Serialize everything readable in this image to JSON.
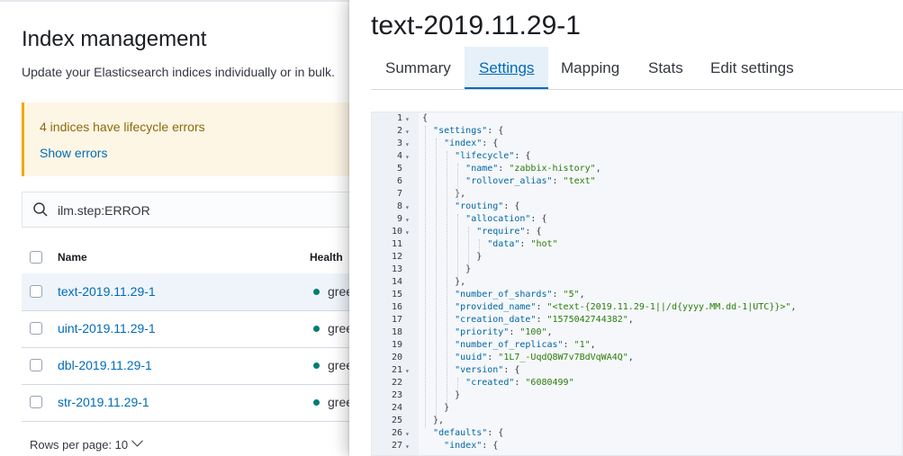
{
  "page": {
    "title": "Index management",
    "description": "Update your Elasticsearch indices individually or in bulk.",
    "callout": {
      "title": "4 indices have lifecycle errors",
      "link": "Show errors"
    },
    "search": {
      "value": "ilm.step:ERROR"
    },
    "table": {
      "headers": {
        "name": "Name",
        "health": "Health"
      },
      "rows": [
        {
          "name": "text-2019.11.29-1",
          "health": "gree"
        },
        {
          "name": "uint-2019.11.29-1",
          "health": "gree"
        },
        {
          "name": "dbl-2019.11.29-1",
          "health": "gree"
        },
        {
          "name": "str-2019.11.29-1",
          "health": "gree"
        }
      ]
    },
    "rows_per_page": "Rows per page: 10"
  },
  "flyout": {
    "title": "text-2019.11.29-1",
    "tabs": [
      "Summary",
      "Settings",
      "Mapping",
      "Stats",
      "Edit settings"
    ],
    "active_tab": "Settings",
    "editor": {
      "lines": [
        "{",
        "  \"settings\": {",
        "    \"index\": {",
        "      \"lifecycle\": {",
        "        \"name\": \"zabbix-history\",",
        "        \"rollover_alias\": \"text\"",
        "      },",
        "      \"routing\": {",
        "        \"allocation\": {",
        "          \"require\": {",
        "            \"data\": \"hot\"",
        "          }",
        "        }",
        "      },",
        "      \"number_of_shards\": \"5\",",
        "      \"provided_name\": \"<text-{2019.11.29-1||/d{yyyy.MM.dd-1|UTC}}>\",",
        "      \"creation_date\": \"1575042744382\",",
        "      \"priority\": \"100\",",
        "      \"number_of_replicas\": \"1\",",
        "      \"uuid\": \"1L7_-UqdQ8W7v7BdVqWA4Q\",",
        "      \"version\": {",
        "        \"created\": \"6080499\"",
        "      }",
        "    }",
        "  },",
        "  \"defaults\": {",
        "    \"index\": {"
      ],
      "fold_lines": [
        1,
        2,
        3,
        4,
        8,
        9,
        10,
        21,
        26,
        27
      ]
    }
  },
  "colors": {
    "link": "#006bb8",
    "warning_bg": "#fef6e5",
    "warning_border": "#f5a700",
    "health_green": "#017d73"
  }
}
